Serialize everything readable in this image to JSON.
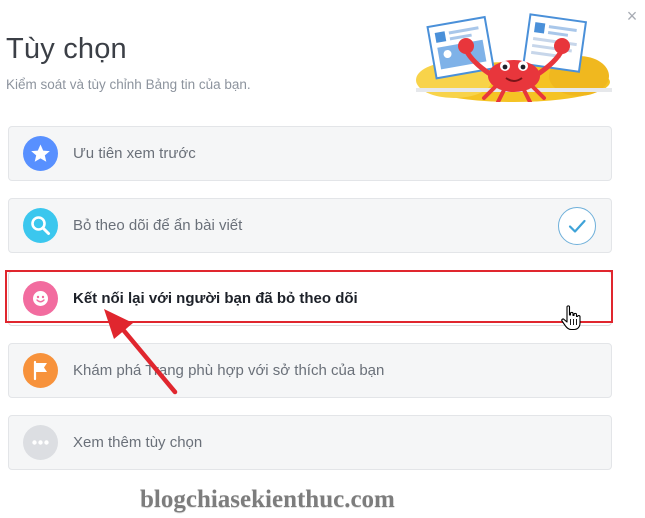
{
  "dialog": {
    "title": "Tùy chọn",
    "subtitle": "Kiểm soát và tùy chỉnh Bảng tin của bạn.",
    "close_icon": "close-icon"
  },
  "options": [
    {
      "label": "Ưu tiên xem trước",
      "icon": "star-icon",
      "icon_color": "#5890ff",
      "selected": false
    },
    {
      "label": "Bỏ theo dõi để ẩn bài viết",
      "icon": "search-icon",
      "icon_color": "#3bc7ee",
      "selected": true
    },
    {
      "label": "Kết nối lại với người bạn đã bỏ theo dõi",
      "icon": "smiley-icon",
      "icon_color": "#f26c9f",
      "selected": false,
      "highlighted": true
    },
    {
      "label": "Khám phá Trang phù hợp với sở thích của bạn",
      "icon": "flag-icon",
      "icon_color": "#f7923b",
      "selected": false
    },
    {
      "label": "Xem thêm tùy chọn",
      "icon": "more-icon",
      "icon_color": "#dcdee2",
      "selected": false
    }
  ],
  "colors": {
    "highlight": "#e0262e",
    "arrow": "#e0262e",
    "check": "#3fa3d8"
  },
  "watermark": "blogchiasekienthuc.com"
}
